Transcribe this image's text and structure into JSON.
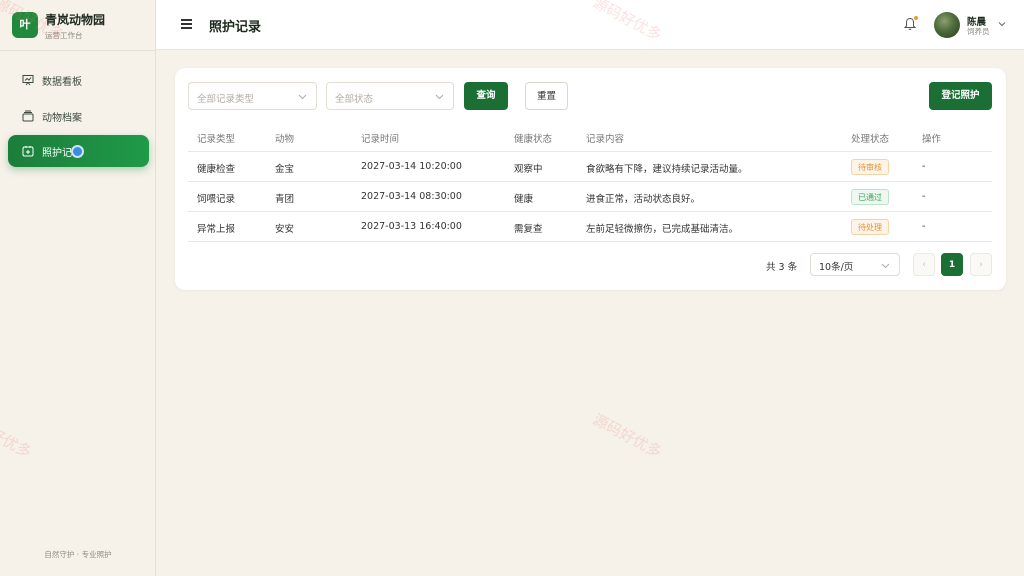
{
  "brand": {
    "logo": "叶",
    "name": "青岚动物园",
    "subtitle": "运营工作台"
  },
  "sidebar": {
    "items": [
      {
        "label": "数据看板",
        "icon": "dashboard-icon"
      },
      {
        "label": "动物档案",
        "icon": "archive-icon"
      },
      {
        "label": "照护记",
        "icon": "care-record-icon",
        "active": true
      }
    ],
    "footer": "自然守护 · 专业照护"
  },
  "header": {
    "title": "照护记录",
    "user": {
      "name": "陈晨",
      "role": "饲养员"
    }
  },
  "filters": {
    "type_placeholder": "全部记录类型",
    "status_placeholder": "全部状态",
    "search_label": "查询",
    "reset_label": "重置",
    "add_label": "登记照护"
  },
  "table": {
    "columns": [
      "记录类型",
      "动物",
      "记录时间",
      "健康状态",
      "记录内容",
      "处理状态",
      "操作"
    ],
    "rows": [
      {
        "type": "健康检查",
        "animal": "金宝",
        "time": "2027-03-14 10:20:00",
        "health": "观察中",
        "content": "食欲略有下降，建议持续记录活动量。",
        "status": "待审核",
        "action": "-"
      },
      {
        "type": "饲喂记录",
        "animal": "青团",
        "time": "2027-03-14 08:30:00",
        "health": "健康",
        "content": "进食正常，活动状态良好。",
        "status": "已通过",
        "action": "-"
      },
      {
        "type": "异常上报",
        "animal": "安安",
        "time": "2027-03-13 16:40:00",
        "health": "需复查",
        "content": "左前足轻微擦伤，已完成基础清洁。",
        "status": "待处理",
        "action": "-"
      }
    ]
  },
  "status_colors": {
    "待审核": "#e8913a",
    "已通过": "#3aa65a",
    "待处理": "#e8913a"
  },
  "pagination": {
    "total": "共 3 条",
    "page_size": "10条/页",
    "current_page": "1",
    "prev": "‹",
    "next": "›"
  },
  "watermark": "源码好优多",
  "colors": {
    "primary": "#1b6f35",
    "accent": "#1f8a3d",
    "background": "#f6f2ea"
  }
}
